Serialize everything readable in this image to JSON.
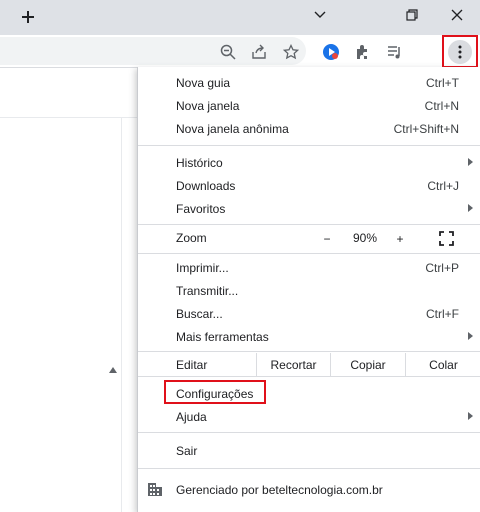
{
  "titlebar": {
    "new_tab_icon": "plus-icon",
    "dropdown_icon": "chevron-down-icon",
    "restore_icon": "restore-icon",
    "close_icon": "close-icon"
  },
  "toolbar": {
    "icons": [
      "zoom-icon",
      "share-icon",
      "bookmark-star-icon",
      "extension-app-icon",
      "extensions-puzzle-icon",
      "media-queue-icon",
      "kebab-menu-icon"
    ]
  },
  "menu": {
    "new_tab": {
      "label": "Nova guia",
      "shortcut": "Ctrl+T"
    },
    "new_window": {
      "label": "Nova janela",
      "shortcut": "Ctrl+N"
    },
    "incognito": {
      "label": "Nova janela anônima",
      "shortcut": "Ctrl+Shift+N"
    },
    "history": {
      "label": "Histórico"
    },
    "downloads": {
      "label": "Downloads",
      "shortcut": "Ctrl+J"
    },
    "bookmarks": {
      "label": "Favoritos"
    },
    "zoom": {
      "label": "Zoom",
      "minus": "−",
      "value": "90%",
      "plus": "+"
    },
    "print": {
      "label": "Imprimir...",
      "shortcut": "Ctrl+P"
    },
    "cast": {
      "label": "Transmitir..."
    },
    "find": {
      "label": "Buscar...",
      "shortcut": "Ctrl+F"
    },
    "more_tools": {
      "label": "Mais ferramentas"
    },
    "edit": {
      "label": "Editar",
      "cut": "Recortar",
      "copy": "Copiar",
      "paste": "Colar"
    },
    "settings": {
      "label": "Configurações"
    },
    "help": {
      "label": "Ajuda"
    },
    "exit": {
      "label": "Sair"
    },
    "managed": {
      "label": "Gerenciado por beteltecnologia.com.br"
    }
  },
  "colors": {
    "highlight": "#e0101a",
    "titlebar": "#dee1e6",
    "menu_text": "#202124"
  }
}
